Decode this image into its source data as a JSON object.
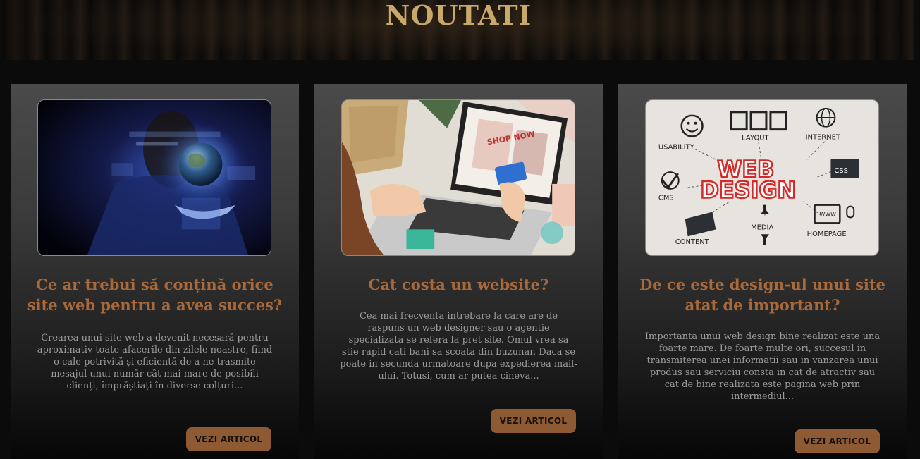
{
  "section": {
    "title": "NOUTATI"
  },
  "articles": [
    {
      "title": "Ce ar trebui să conțină orice site web pentru a avea succes?",
      "excerpt": "Crearea unui site web a devenit necesară pentru aproximativ toate afacerile din zilele noastre, fiind o cale potrivită și eficientă de a ne trasmite mesajul unui număr cât mai mare de posibili clienți, împrăștiați în diverse colțuri...",
      "button": "VEZI ARTICOL",
      "image_icon": "hand-globe-hologram-image"
    },
    {
      "title": "Cat costa un website?",
      "excerpt": "Cea mai frecventa intrebare la care are de raspuns un web designer sau o agentie specializata se refera la pret site. Omul vrea sa stie rapid cati bani sa scoata din buzunar. Daca se poate in secunda urmatoare dupa expedierea mail-ului. Totusi, cum ar putea cineva...",
      "button": "VEZI ARTICOL",
      "image_icon": "laptop-shopping-image"
    },
    {
      "title": "De ce este design-ul unui site atat de important?",
      "excerpt": "Importanta unui web design bine realizat este una foarte mare. De foarte multe ori, succesul in transmiterea unei informatii sau in vanzarea unui produs sau serviciu consta in cat de atractiv sau cat de bine realizata este pagina web prin intermediul...",
      "button": "VEZI ARTICOL",
      "image_icon": "web-design-diagram-image",
      "image_text": {
        "headline_1": "WEB",
        "headline_2": "DESIGN",
        "labels": [
          "USABILITY",
          "LAYOUT",
          "INTERNET",
          "CSS",
          "CMS",
          "MEDIA",
          "CONTENT",
          "HOMEPAGE",
          "WWW"
        ]
      }
    }
  ],
  "colors": {
    "title_gold": "#c9a96a",
    "article_title": "#a9693a",
    "button_bg": "#8e5a34"
  }
}
